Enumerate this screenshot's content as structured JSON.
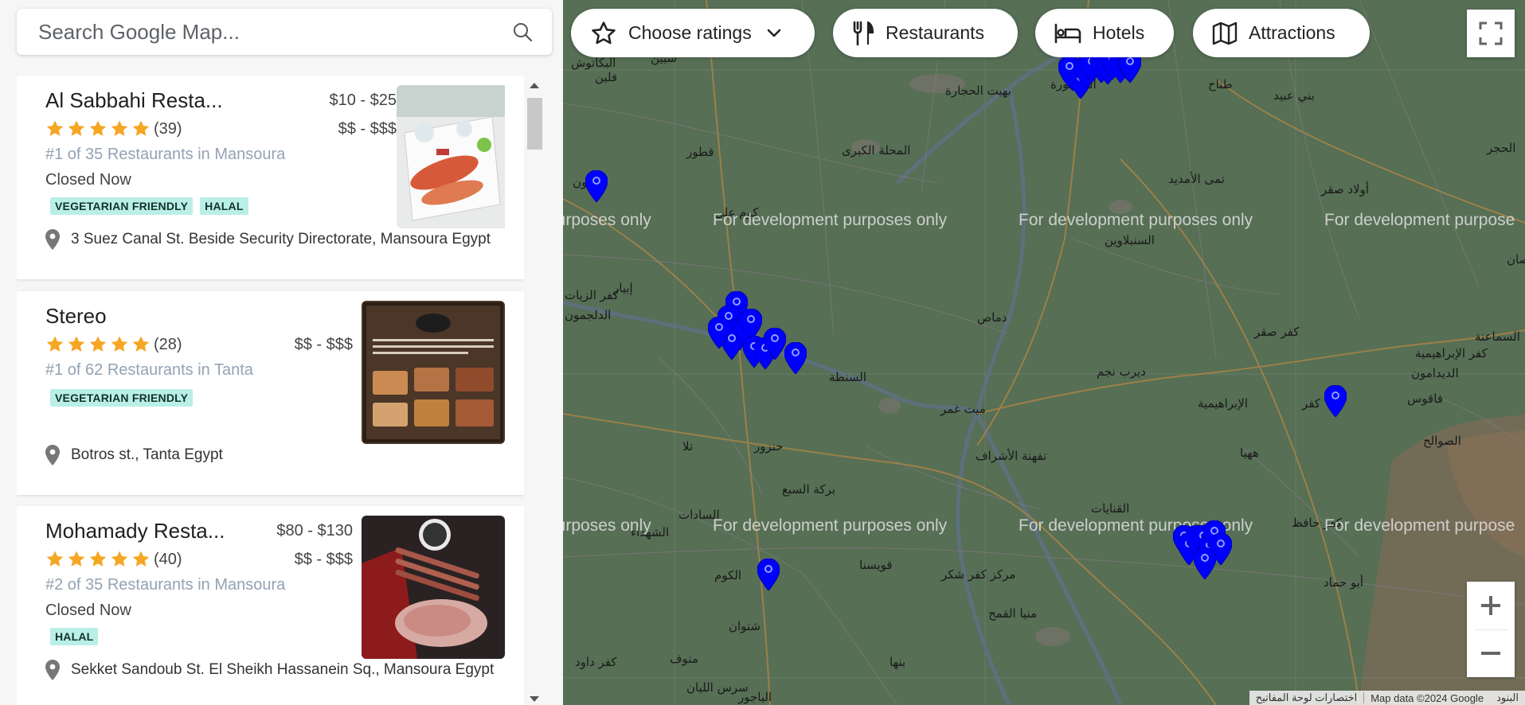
{
  "search": {
    "placeholder": "Search Google Map..."
  },
  "results": [
    {
      "name": "Al Sabbahi Resta...",
      "price_range": "$10 - $25",
      "price_level": "$$ - $$$",
      "rating_stars": 5,
      "review_count": "(39)",
      "rank": "#1 of 35 Restaurants in Mansoura",
      "status": "Closed Now",
      "tags": [
        "VEGETARIAN FRIENDLY",
        "HALAL"
      ],
      "address": "3 Suez Canal St. Beside Security Directorate, Mansoura Egypt"
    },
    {
      "name": "Stereo",
      "price_range": "",
      "price_level": "$$ - $$$",
      "rating_stars": 5,
      "review_count": "(28)",
      "rank": "#1 of 62 Restaurants in Tanta",
      "status": "",
      "tags": [
        "VEGETARIAN FRIENDLY"
      ],
      "address": "Botros st., Tanta Egypt"
    },
    {
      "name": "Mohamady Resta...",
      "price_range": "$80 - $130",
      "price_level": "$$ - $$$",
      "rating_stars": 5,
      "review_count": "(40)",
      "rank": "#2 of 35 Restaurants in Mansoura",
      "status": "Closed Now",
      "tags": [
        "HALAL"
      ],
      "address": "Sekket Sandoub St. El Sheikh Hassanein Sq., Mansoura Egypt"
    }
  ],
  "filters": {
    "ratings_label": "Choose ratings",
    "restaurants_label": "Restaurants",
    "hotels_label": "Hotels",
    "attractions_label": "Attractions"
  },
  "map": {
    "watermark": "For development purposes only",
    "watermark_partial": "purposes only",
    "watermark_partial_right": "For development purpose",
    "places": [
      "البكاتوش",
      "فلين",
      "شبين",
      "قطور",
      "بسيون",
      "كوم علي",
      "المحلة الكبرى",
      "بهيت الحجارة",
      "طناح",
      "بني عبيد",
      "تمى الأمديد",
      "أولاد صقر",
      "السنبلاوين",
      "كفر الزيات",
      "إبيار",
      "الدلجمون",
      "دماص",
      "كفر صقر",
      "السماعنة",
      "السنطة",
      "ديرب نجم",
      "الديدامون",
      "فاقوس",
      "الإبراهيمية",
      "كفر",
      "الصوالح",
      "ميت غمر",
      "حنزور",
      "تلا",
      "تفهنة الأشراف",
      "ههيا",
      "بركة السبع",
      "القنايات",
      "الشهداء",
      "السادات",
      "كفر حافظ",
      "أبو حماد",
      "قويسنا",
      "مركز كفر شكر",
      "الكوم",
      "شنوان",
      "منيا القمح",
      "كفر داود",
      "منوف",
      "بنها",
      "سرس الليان",
      "الباجور",
      "الحجر",
      "صان",
      "المنصورة",
      "كفر الإبراهيمية"
    ],
    "zoom_in": "+",
    "zoom_out": "−",
    "attribution_shortcuts": "اختصارات لوحة المفاتيح",
    "attribution_data": "Map data ©2024 Google",
    "attribution_terms": "البنود"
  },
  "colors": {
    "accent_tag_bg": "#b9efe7",
    "star": "#f5a623",
    "marker": "#0000ff",
    "map_land": "#566f55"
  }
}
